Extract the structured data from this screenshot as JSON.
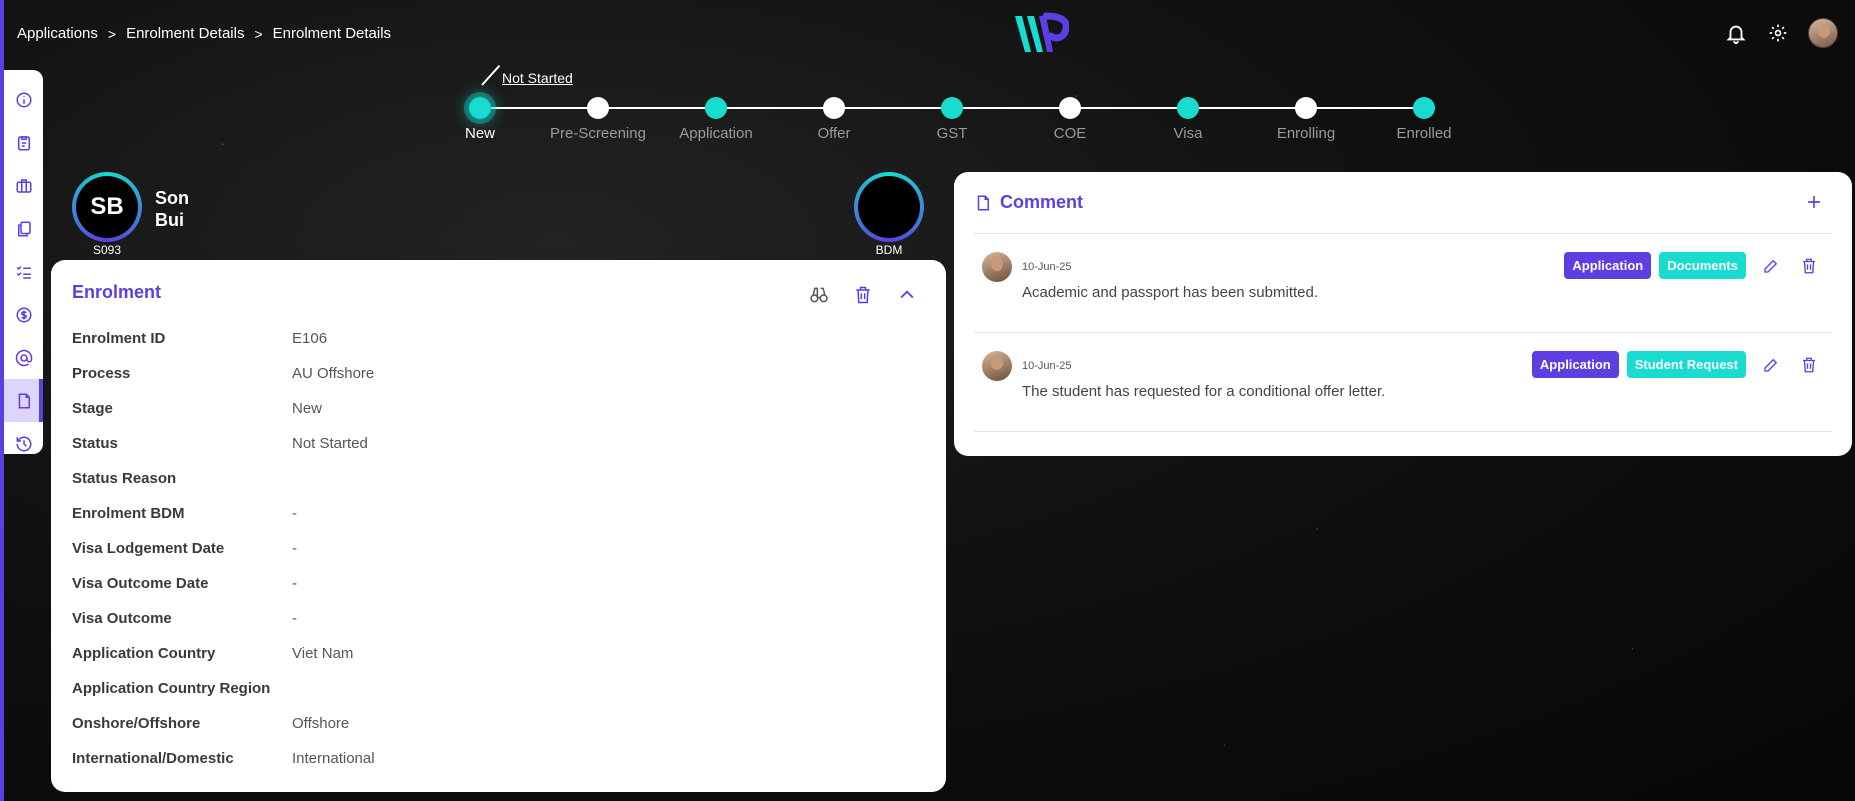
{
  "breadcrumb": [
    "Applications",
    "Enrolment Details",
    "Enrolment Details"
  ],
  "breadcrumb_separator": ">",
  "header": {
    "logo_icon": "wp-logo-icon",
    "icons": [
      "bell-icon",
      "gear-icon",
      "user-avatar"
    ]
  },
  "sidebar": {
    "items": [
      {
        "icon": "info-icon",
        "active": false
      },
      {
        "icon": "clipboard-icon",
        "active": false
      },
      {
        "icon": "briefcase-icon",
        "active": false
      },
      {
        "icon": "documents-icon",
        "active": false
      },
      {
        "icon": "checklist-icon",
        "active": false
      },
      {
        "icon": "dollar-icon",
        "active": false
      },
      {
        "icon": "at-icon",
        "active": false
      },
      {
        "icon": "file-icon",
        "active": true
      },
      {
        "icon": "history-icon",
        "active": false
      }
    ]
  },
  "stepper": {
    "status": "Not Started",
    "steps": [
      {
        "label": "New",
        "color": "teal",
        "current": true
      },
      {
        "label": "Pre-Screening",
        "color": "white",
        "current": false
      },
      {
        "label": "Application",
        "color": "teal",
        "current": false
      },
      {
        "label": "Offer",
        "color": "white",
        "current": false
      },
      {
        "label": "GST",
        "color": "teal",
        "current": false
      },
      {
        "label": "COE",
        "color": "white",
        "current": false
      },
      {
        "label": "Visa",
        "color": "teal",
        "current": false
      },
      {
        "label": "Enrolling",
        "color": "white",
        "current": false
      },
      {
        "label": "Enrolled",
        "color": "teal",
        "current": false
      }
    ]
  },
  "student": {
    "initials": "SB",
    "first_name": "Son",
    "last_name": "Bui",
    "id": "S093"
  },
  "bdm": {
    "label": "BDM"
  },
  "enrolment": {
    "title": "Enrolment",
    "actions": [
      "binoculars-icon",
      "trash-icon",
      "chevron-up-icon"
    ],
    "fields": [
      {
        "label": "Enrolment ID",
        "value": "E106"
      },
      {
        "label": "Process",
        "value": "AU Offshore"
      },
      {
        "label": "Stage",
        "value": "New"
      },
      {
        "label": "Status",
        "value": "Not Started"
      },
      {
        "label": "Status Reason",
        "value": ""
      },
      {
        "label": "Enrolment BDM",
        "value": "-"
      },
      {
        "label": "Visa Lodgement Date",
        "value": "-"
      },
      {
        "label": "Visa Outcome Date",
        "value": "-"
      },
      {
        "label": "Visa Outcome",
        "value": "-"
      },
      {
        "label": "Application Country",
        "value": "Viet Nam"
      },
      {
        "label": "Application Country Region",
        "value": ""
      },
      {
        "label": "Onshore/Offshore",
        "value": "Offshore"
      },
      {
        "label": "International/Domestic",
        "value": "International"
      }
    ]
  },
  "comments": {
    "title": "Comment",
    "add_icon": "plus-icon",
    "items": [
      {
        "date": "10-Jun-25",
        "text": "Academic and passport has been submitted.",
        "tags": [
          {
            "label": "Application",
            "color": "purple"
          },
          {
            "label": "Documents",
            "color": "teal"
          }
        ]
      },
      {
        "date": "10-Jun-25",
        "text": "The student has requested for a conditional offer letter.",
        "tags": [
          {
            "label": "Application",
            "color": "purple"
          },
          {
            "label": "Student Request",
            "color": "teal"
          }
        ]
      }
    ]
  },
  "colors": {
    "accent": "#5b3fe0",
    "teal": "#17dccf"
  }
}
